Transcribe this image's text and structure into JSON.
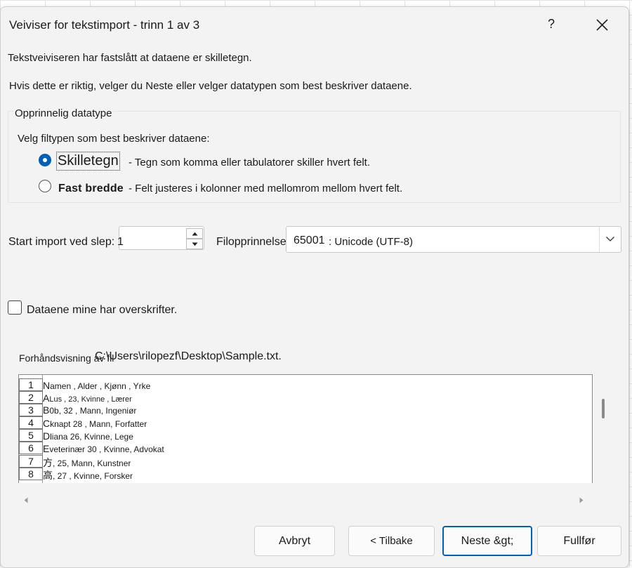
{
  "dialog": {
    "title": "Veiviser for tekstimport - trinn 1 av 3",
    "help_label": "?",
    "close_icon": "close-icon"
  },
  "intro": {
    "line1": "Tekstveiviseren har fastslått at dataene er skilletegn.",
    "line2": "Hvis dette er riktig, velger du Neste eller velger datatypen som best beskriver dataene."
  },
  "datatype_group": {
    "title": "Opprinnelig datatype",
    "prompt": "Velg filtypen som best beskriver dataene:",
    "options": [
      {
        "label": "Skilletegn",
        "description": "- Tegn som komma eller tabulatorer skiller hvert felt.",
        "selected": true
      },
      {
        "label": "Fast bredde",
        "description": "- Felt justeres i kolonner med mellomrom mellom hvert felt.",
        "selected": false
      }
    ]
  },
  "start_row": {
    "label": "Start import ved slep:",
    "value": "1"
  },
  "file_origin": {
    "label": "Filopprinnelse",
    "code": "65001",
    "name": ": Unicode (UTF-8)"
  },
  "headers_checkbox": {
    "label": "Dataene mine har overskrifter.",
    "checked": false
  },
  "preview": {
    "label": "Forhåndsvisning av fil",
    "path": "C:\\Users\\rilopezf\\Desktop\\Sample.txt.",
    "rows": [
      {
        "num": "1",
        "lead": "N",
        "text": "amen , Alder , Kjønn , Yrke"
      },
      {
        "num": "2",
        "lead": "A",
        "text": "Lus , 23, Kvinne , Lærer"
      },
      {
        "num": "3",
        "lead": "B",
        "text": "0b, 32 , Mann, Ingeniør"
      },
      {
        "num": "4",
        "lead": "C",
        "text": "knapt 28 , Mann, Forfatter"
      },
      {
        "num": "5",
        "lead": "D",
        "text": "liana 26, Kvinne, Lege"
      },
      {
        "num": "6",
        "lead": "E",
        "text": "veterinær 30 , Kvinne, Advokat"
      },
      {
        "num": "7",
        "lead": "方",
        "text": ", 25, Mann, Kunstner"
      },
      {
        "num": "8",
        "lead": "高",
        "text": ", 27 , Kvinne, Forsker"
      }
    ]
  },
  "buttons": {
    "cancel": "Avbryt",
    "back": "< Tilbake",
    "next": "Neste &gt;",
    "finish": "Fullfør"
  },
  "colors": {
    "accent": "#005fb8",
    "dialog_bg": "#f3f3f3"
  }
}
